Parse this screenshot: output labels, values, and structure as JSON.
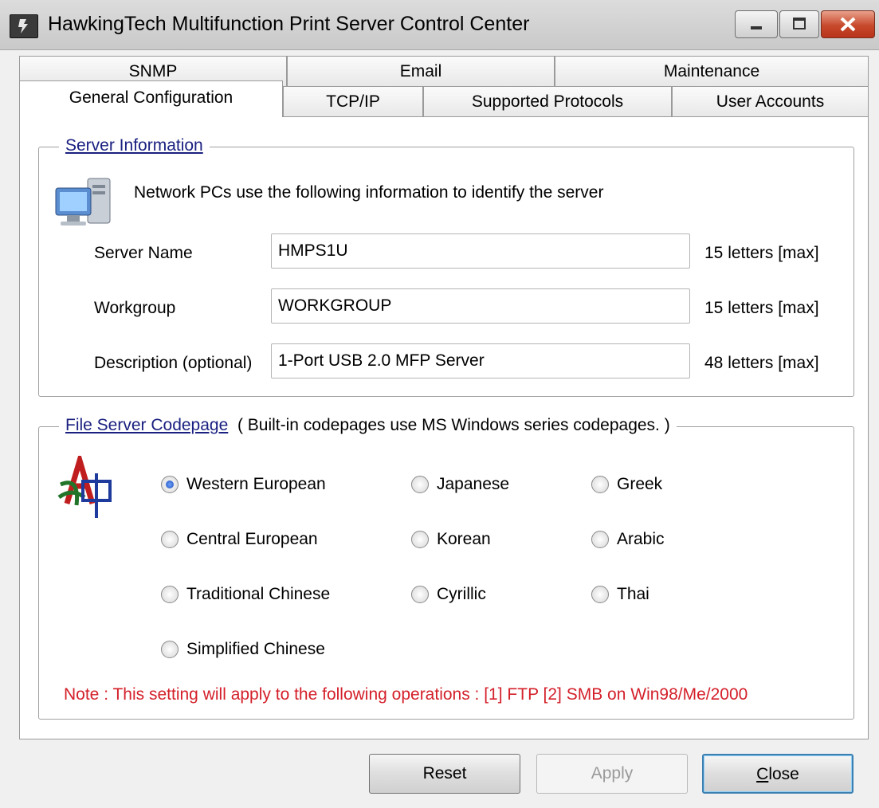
{
  "window": {
    "title": "HawkingTech Multifunction Print Server Control Center"
  },
  "tabs": {
    "row_back": [
      "SNMP",
      "Email",
      "Maintenance"
    ],
    "row_front": [
      "General Configuration",
      "TCP/IP",
      "Supported Protocols",
      "User Accounts"
    ],
    "active": "General Configuration"
  },
  "server_info": {
    "legend": "Server Information",
    "description": "Network PCs use the following information to identify the server",
    "fields": [
      {
        "label": "Server Name",
        "value": "HMPS1U",
        "hint": "15 letters [max]"
      },
      {
        "label": "Workgroup",
        "value": "WORKGROUP",
        "hint": "15 letters [max]"
      },
      {
        "label": "Description (optional)",
        "value": "1-Port  USB 2.0 MFP Server",
        "hint": "48 letters [max]"
      }
    ]
  },
  "codepage": {
    "legend": "File Server Codepage",
    "legend_note": "( Built-in codepages use MS Windows series codepages. )",
    "options": [
      {
        "label": "Western European",
        "checked": true
      },
      {
        "label": "Central European",
        "checked": false
      },
      {
        "label": "Traditional Chinese",
        "checked": false
      },
      {
        "label": "Simplified Chinese",
        "checked": false
      },
      {
        "label": "Japanese",
        "checked": false
      },
      {
        "label": "Korean",
        "checked": false
      },
      {
        "label": "Cyrillic",
        "checked": false
      },
      {
        "label": "Greek",
        "checked": false
      },
      {
        "label": "Arabic",
        "checked": false
      },
      {
        "label": "Thai",
        "checked": false
      }
    ],
    "note": "Note : This setting will apply to the following operations : [1] FTP  [2] SMB on Win98/Me/2000",
    "note_color": "#d4202a"
  },
  "buttons": {
    "reset": "Reset",
    "apply": "Apply",
    "close_first": "C",
    "close_rest": "lose"
  },
  "colors": {
    "legend_link": "#1a2080",
    "accent_button_border": "#3c7fb1"
  }
}
